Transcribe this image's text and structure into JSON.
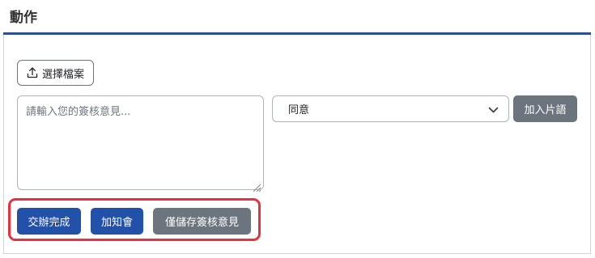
{
  "header": {
    "title": "動作"
  },
  "upload": {
    "label": "選擇檔案",
    "icon": "upload-icon"
  },
  "comment": {
    "placeholder": "請輸入您的簽核意見...",
    "value": ""
  },
  "phrase_select": {
    "selected": "同意"
  },
  "phrase_button": {
    "label": "加入片語"
  },
  "actions": {
    "complete_label": "交辦完成",
    "add_notify_label": "加知會",
    "save_only_label": "僅儲存簽核意見"
  },
  "colors": {
    "primary": "#2350a8",
    "secondary": "#6c757d",
    "highlight": "#e8303e",
    "header_rule": "#2c4f96"
  }
}
